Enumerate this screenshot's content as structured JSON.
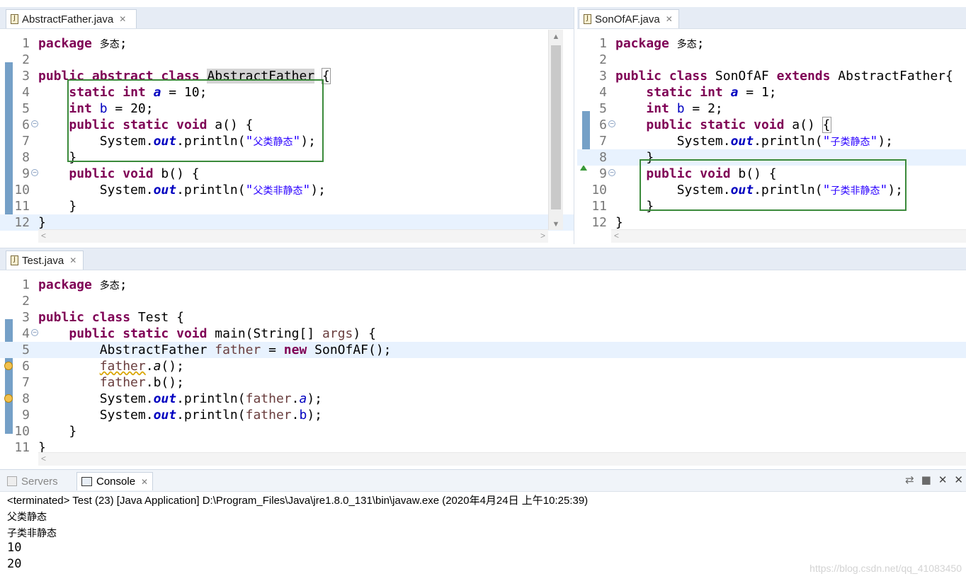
{
  "editors": {
    "abstract_father": {
      "tab_label": "AbstractFather.java",
      "lines": [
        {
          "n": "1",
          "html": "<span class='kw'>package</span> <span class='cn'>多态</span>;"
        },
        {
          "n": "2",
          "html": ""
        },
        {
          "n": "3",
          "html": "<span class='kw'>public</span> <span class='kw'>abstract</span> <span class='kw'>class</span> <span class='occ'>AbstractFather</span> <span style='outline:1px solid #999'>{</span>"
        },
        {
          "n": "4",
          "html": "    <span class='kw'>static</span> <span class='kw'>int</span> <span class='sfld'>a</span> = 10;"
        },
        {
          "n": "5",
          "html": "    <span class='kw'>int</span> <span class='fld'>b</span> = 20;"
        },
        {
          "n": "6",
          "html": "    <span class='kw'>public</span> <span class='kw'>static</span> <span class='kw'>void</span> a() {",
          "fold": true
        },
        {
          "n": "7",
          "html": "        System.<span class='sfld'>out</span>.println(<span class='str'>\"<span class='cn'>父类静态</span>\"</span>);"
        },
        {
          "n": "8",
          "html": "    }"
        },
        {
          "n": "9",
          "html": "    <span class='kw'>public</span> <span class='kw'>void</span> b() {",
          "fold": true
        },
        {
          "n": "10",
          "html": "        System.<span class='sfld'>out</span>.println(<span class='str'>\"<span class='cn'>父类非静态</span>\"</span>);"
        },
        {
          "n": "11",
          "html": "    }"
        },
        {
          "n": "12",
          "html": "}",
          "hl": true
        }
      ]
    },
    "son_of_af": {
      "tab_label": "SonOfAF.java",
      "lines": [
        {
          "n": "1",
          "html": "<span class='kw'>package</span> <span class='cn'>多态</span>;"
        },
        {
          "n": "2",
          "html": ""
        },
        {
          "n": "3",
          "html": "<span class='kw'>public</span> <span class='kw'>class</span> SonOfAF <span class='kw'>extends</span> AbstractFather{"
        },
        {
          "n": "4",
          "html": "    <span class='kw'>static</span> <span class='kw'>int</span> <span class='sfld'>a</span> = 1;"
        },
        {
          "n": "5",
          "html": "    <span class='kw'>int</span> <span class='fld'>b</span> = 2;"
        },
        {
          "n": "6",
          "html": "    <span class='kw'>public</span> <span class='kw'>static</span> <span class='kw'>void</span> a() <span style='outline:1px solid #999'>{</span>",
          "fold": true
        },
        {
          "n": "7",
          "html": "        System.<span class='sfld'>out</span>.println(<span class='str'>\"<span class='cn'>子类静态</span>\"</span>);"
        },
        {
          "n": "8",
          "html": "    }",
          "hl": true
        },
        {
          "n": "9",
          "html": "    <span class='kw'>public</span> <span class='kw'>void</span> b() {",
          "fold": true,
          "override": true
        },
        {
          "n": "10",
          "html": "        System.<span class='sfld'>out</span>.println(<span class='str'>\"<span class='cn'>子类非静态</span>\"</span>);"
        },
        {
          "n": "11",
          "html": "    }"
        },
        {
          "n": "12",
          "html": "}"
        }
      ]
    },
    "test": {
      "tab_label": "Test.java",
      "lines": [
        {
          "n": "1",
          "html": "<span class='kw'>package</span> <span class='cn'>多态</span>;"
        },
        {
          "n": "2",
          "html": ""
        },
        {
          "n": "3",
          "html": "<span class='kw'>public</span> <span class='kw'>class</span> Test {"
        },
        {
          "n": "4",
          "html": "    <span class='kw'>public</span> <span class='kw'>static</span> <span class='kw'>void</span> main(String[] <span class='var'>args</span>) {",
          "fold": true
        },
        {
          "n": "5",
          "html": "        AbstractFather <span class='var'>father</span> = <span class='kw'>new</span> SonOfAF();",
          "hl": true
        },
        {
          "n": "6",
          "html": "        <span class='var' style='text-decoration:underline wavy #d9a400'>father</span>.<i>a</i>();",
          "warn": true
        },
        {
          "n": "7",
          "html": "        <span class='var'>father</span>.b();"
        },
        {
          "n": "8",
          "html": "        System.<span class='sfld'>out</span>.println(<span class='var'>father</span>.<span class='sfld' style='font-weight:normal'>a</span>);",
          "warn": true
        },
        {
          "n": "9",
          "html": "        System.<span class='sfld'>out</span>.println(<span class='var'>father</span>.<span class='fld'>b</span>);"
        },
        {
          "n": "10",
          "html": "    }"
        },
        {
          "n": "11",
          "html": "}"
        }
      ]
    }
  },
  "console": {
    "tabs": {
      "servers": "Servers",
      "console": "Console"
    },
    "header": "<terminated> Test (23) [Java Application] D:\\Program_Files\\Java\\jre1.8.0_131\\bin\\javaw.exe (2020年4月24日 上午10:25:39)",
    "output": [
      "父类静态",
      "子类非静态",
      "10",
      "20"
    ]
  },
  "watermark": "https://blog.csdn.net/qq_41083450"
}
